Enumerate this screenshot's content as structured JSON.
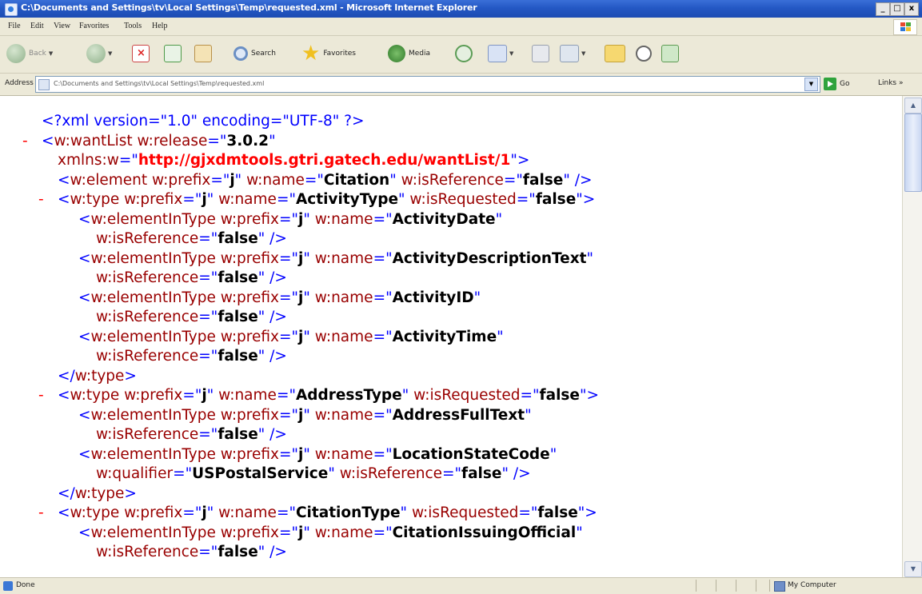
{
  "window": {
    "title": "C:\\Documents and Settings\\tv\\Local Settings\\Temp\\requested.xml - Microsoft Internet Explorer",
    "min": "_",
    "max": "□",
    "close": "x"
  },
  "menu": [
    "File",
    "Edit",
    "View",
    "Favorites",
    "Tools",
    "Help"
  ],
  "toolbar": {
    "back": "Back",
    "search": "Search",
    "favorites": "Favorites",
    "media": "Media"
  },
  "address": {
    "label": "Address",
    "value": "C:\\Documents and Settings\\tv\\Local Settings\\Temp\\requested.xml",
    "go": "Go",
    "links": "Links »"
  },
  "xml": [
    {
      "indent": 0,
      "parts": [
        [
          "b",
          "<?xml version=\"1.0\" encoding=\"UTF-8\" ?>"
        ]
      ]
    },
    {
      "indent": 0,
      "minus": "-",
      "parts": [
        [
          "b",
          "<"
        ],
        [
          "r",
          "w:wantList w:release"
        ],
        [
          "b",
          "=\""
        ],
        [
          "k",
          "3.0.2"
        ],
        [
          "b",
          "\""
        ]
      ]
    },
    {
      "indent": 1,
      "parts": [
        [
          "r",
          "xmlns:w"
        ],
        [
          "b",
          "=\""
        ],
        [
          "rb",
          "http://gjxdmtools.gtri.gatech.edu/wantList/1"
        ],
        [
          "b",
          "\">"
        ]
      ]
    },
    {
      "indent": 1,
      "parts": [
        [
          "b",
          "<"
        ],
        [
          "r",
          "w:element w:prefix"
        ],
        [
          "b",
          "=\""
        ],
        [
          "k",
          "j"
        ],
        [
          "b",
          "\" "
        ],
        [
          "r",
          "w:name"
        ],
        [
          "b",
          "=\""
        ],
        [
          "k",
          "Citation"
        ],
        [
          "b",
          "\" "
        ],
        [
          "r",
          "w:isReference"
        ],
        [
          "b",
          "=\""
        ],
        [
          "k",
          "false"
        ],
        [
          "b",
          "\" />"
        ]
      ]
    },
    {
      "indent": 1,
      "minus": "-",
      "parts": [
        [
          "b",
          "<"
        ],
        [
          "r",
          "w:type w:prefix"
        ],
        [
          "b",
          "=\""
        ],
        [
          "k",
          "j"
        ],
        [
          "b",
          "\" "
        ],
        [
          "r",
          "w:name"
        ],
        [
          "b",
          "=\""
        ],
        [
          "k",
          "ActivityType"
        ],
        [
          "b",
          "\" "
        ],
        [
          "r",
          "w:isRequested"
        ],
        [
          "b",
          "=\""
        ],
        [
          "k",
          "false"
        ],
        [
          "b",
          "\">"
        ]
      ]
    },
    {
      "indent": 2,
      "parts": [
        [
          "b",
          "<"
        ],
        [
          "r",
          "w:elementInType w:prefix"
        ],
        [
          "b",
          "=\""
        ],
        [
          "k",
          "j"
        ],
        [
          "b",
          "\" "
        ],
        [
          "r",
          "w:name"
        ],
        [
          "b",
          "=\""
        ],
        [
          "k",
          "ActivityDate"
        ],
        [
          "b",
          "\""
        ]
      ]
    },
    {
      "indent": 3,
      "parts": [
        [
          "r",
          "w:isReference"
        ],
        [
          "b",
          "=\""
        ],
        [
          "k",
          "false"
        ],
        [
          "b",
          "\" />"
        ]
      ]
    },
    {
      "indent": 2,
      "parts": [
        [
          "b",
          "<"
        ],
        [
          "r",
          "w:elementInType w:prefix"
        ],
        [
          "b",
          "=\""
        ],
        [
          "k",
          "j"
        ],
        [
          "b",
          "\" "
        ],
        [
          "r",
          "w:name"
        ],
        [
          "b",
          "=\""
        ],
        [
          "k",
          "ActivityDescriptionText"
        ],
        [
          "b",
          "\""
        ]
      ]
    },
    {
      "indent": 3,
      "parts": [
        [
          "r",
          "w:isReference"
        ],
        [
          "b",
          "=\""
        ],
        [
          "k",
          "false"
        ],
        [
          "b",
          "\" />"
        ]
      ]
    },
    {
      "indent": 2,
      "parts": [
        [
          "b",
          "<"
        ],
        [
          "r",
          "w:elementInType w:prefix"
        ],
        [
          "b",
          "=\""
        ],
        [
          "k",
          "j"
        ],
        [
          "b",
          "\" "
        ],
        [
          "r",
          "w:name"
        ],
        [
          "b",
          "=\""
        ],
        [
          "k",
          "ActivityID"
        ],
        [
          "b",
          "\""
        ]
      ]
    },
    {
      "indent": 3,
      "parts": [
        [
          "r",
          "w:isReference"
        ],
        [
          "b",
          "=\""
        ],
        [
          "k",
          "false"
        ],
        [
          "b",
          "\" />"
        ]
      ]
    },
    {
      "indent": 2,
      "parts": [
        [
          "b",
          "<"
        ],
        [
          "r",
          "w:elementInType w:prefix"
        ],
        [
          "b",
          "=\""
        ],
        [
          "k",
          "j"
        ],
        [
          "b",
          "\" "
        ],
        [
          "r",
          "w:name"
        ],
        [
          "b",
          "=\""
        ],
        [
          "k",
          "ActivityTime"
        ],
        [
          "b",
          "\""
        ]
      ]
    },
    {
      "indent": 3,
      "parts": [
        [
          "r",
          "w:isReference"
        ],
        [
          "b",
          "=\""
        ],
        [
          "k",
          "false"
        ],
        [
          "b",
          "\" />"
        ]
      ]
    },
    {
      "indent": 1,
      "parts": [
        [
          "b",
          "</"
        ],
        [
          "r",
          "w:type"
        ],
        [
          "b",
          ">"
        ]
      ]
    },
    {
      "indent": 1,
      "minus": "-",
      "parts": [
        [
          "b",
          "<"
        ],
        [
          "r",
          "w:type w:prefix"
        ],
        [
          "b",
          "=\""
        ],
        [
          "k",
          "j"
        ],
        [
          "b",
          "\" "
        ],
        [
          "r",
          "w:name"
        ],
        [
          "b",
          "=\""
        ],
        [
          "k",
          "AddressType"
        ],
        [
          "b",
          "\" "
        ],
        [
          "r",
          "w:isRequested"
        ],
        [
          "b",
          "=\""
        ],
        [
          "k",
          "false"
        ],
        [
          "b",
          "\">"
        ]
      ]
    },
    {
      "indent": 2,
      "parts": [
        [
          "b",
          "<"
        ],
        [
          "r",
          "w:elementInType w:prefix"
        ],
        [
          "b",
          "=\""
        ],
        [
          "k",
          "j"
        ],
        [
          "b",
          "\" "
        ],
        [
          "r",
          "w:name"
        ],
        [
          "b",
          "=\""
        ],
        [
          "k",
          "AddressFullText"
        ],
        [
          "b",
          "\""
        ]
      ]
    },
    {
      "indent": 3,
      "parts": [
        [
          "r",
          "w:isReference"
        ],
        [
          "b",
          "=\""
        ],
        [
          "k",
          "false"
        ],
        [
          "b",
          "\" />"
        ]
      ]
    },
    {
      "indent": 2,
      "parts": [
        [
          "b",
          "<"
        ],
        [
          "r",
          "w:elementInType w:prefix"
        ],
        [
          "b",
          "=\""
        ],
        [
          "k",
          "j"
        ],
        [
          "b",
          "\" "
        ],
        [
          "r",
          "w:name"
        ],
        [
          "b",
          "=\""
        ],
        [
          "k",
          "LocationStateCode"
        ],
        [
          "b",
          "\""
        ]
      ]
    },
    {
      "indent": 3,
      "parts": [
        [
          "r",
          "w:qualifier"
        ],
        [
          "b",
          "=\""
        ],
        [
          "k",
          "USPostalService"
        ],
        [
          "b",
          "\" "
        ],
        [
          "r",
          "w:isReference"
        ],
        [
          "b",
          "=\""
        ],
        [
          "k",
          "false"
        ],
        [
          "b",
          "\" />"
        ]
      ]
    },
    {
      "indent": 1,
      "parts": [
        [
          "b",
          "</"
        ],
        [
          "r",
          "w:type"
        ],
        [
          "b",
          ">"
        ]
      ]
    },
    {
      "indent": 1,
      "minus": "-",
      "parts": [
        [
          "b",
          "<"
        ],
        [
          "r",
          "w:type w:prefix"
        ],
        [
          "b",
          "=\""
        ],
        [
          "k",
          "j"
        ],
        [
          "b",
          "\" "
        ],
        [
          "r",
          "w:name"
        ],
        [
          "b",
          "=\""
        ],
        [
          "k",
          "CitationType"
        ],
        [
          "b",
          "\" "
        ],
        [
          "r",
          "w:isRequested"
        ],
        [
          "b",
          "=\""
        ],
        [
          "k",
          "false"
        ],
        [
          "b",
          "\">"
        ]
      ]
    },
    {
      "indent": 2,
      "parts": [
        [
          "b",
          "<"
        ],
        [
          "r",
          "w:elementInType w:prefix"
        ],
        [
          "b",
          "=\""
        ],
        [
          "k",
          "j"
        ],
        [
          "b",
          "\" "
        ],
        [
          "r",
          "w:name"
        ],
        [
          "b",
          "=\""
        ],
        [
          "k",
          "CitationIssuingOfficial"
        ],
        [
          "b",
          "\""
        ]
      ]
    },
    {
      "indent": 3,
      "parts": [
        [
          "r",
          "w:isReference"
        ],
        [
          "b",
          "=\""
        ],
        [
          "k",
          "false"
        ],
        [
          "b",
          "\" />"
        ]
      ]
    }
  ],
  "status": {
    "text": "Done",
    "zone": "My Computer"
  },
  "colors": {
    "markup": "#0000ff",
    "name": "#990000",
    "value": "#000000",
    "collapse": "#ff0000",
    "titlebar": "#2458c4"
  }
}
